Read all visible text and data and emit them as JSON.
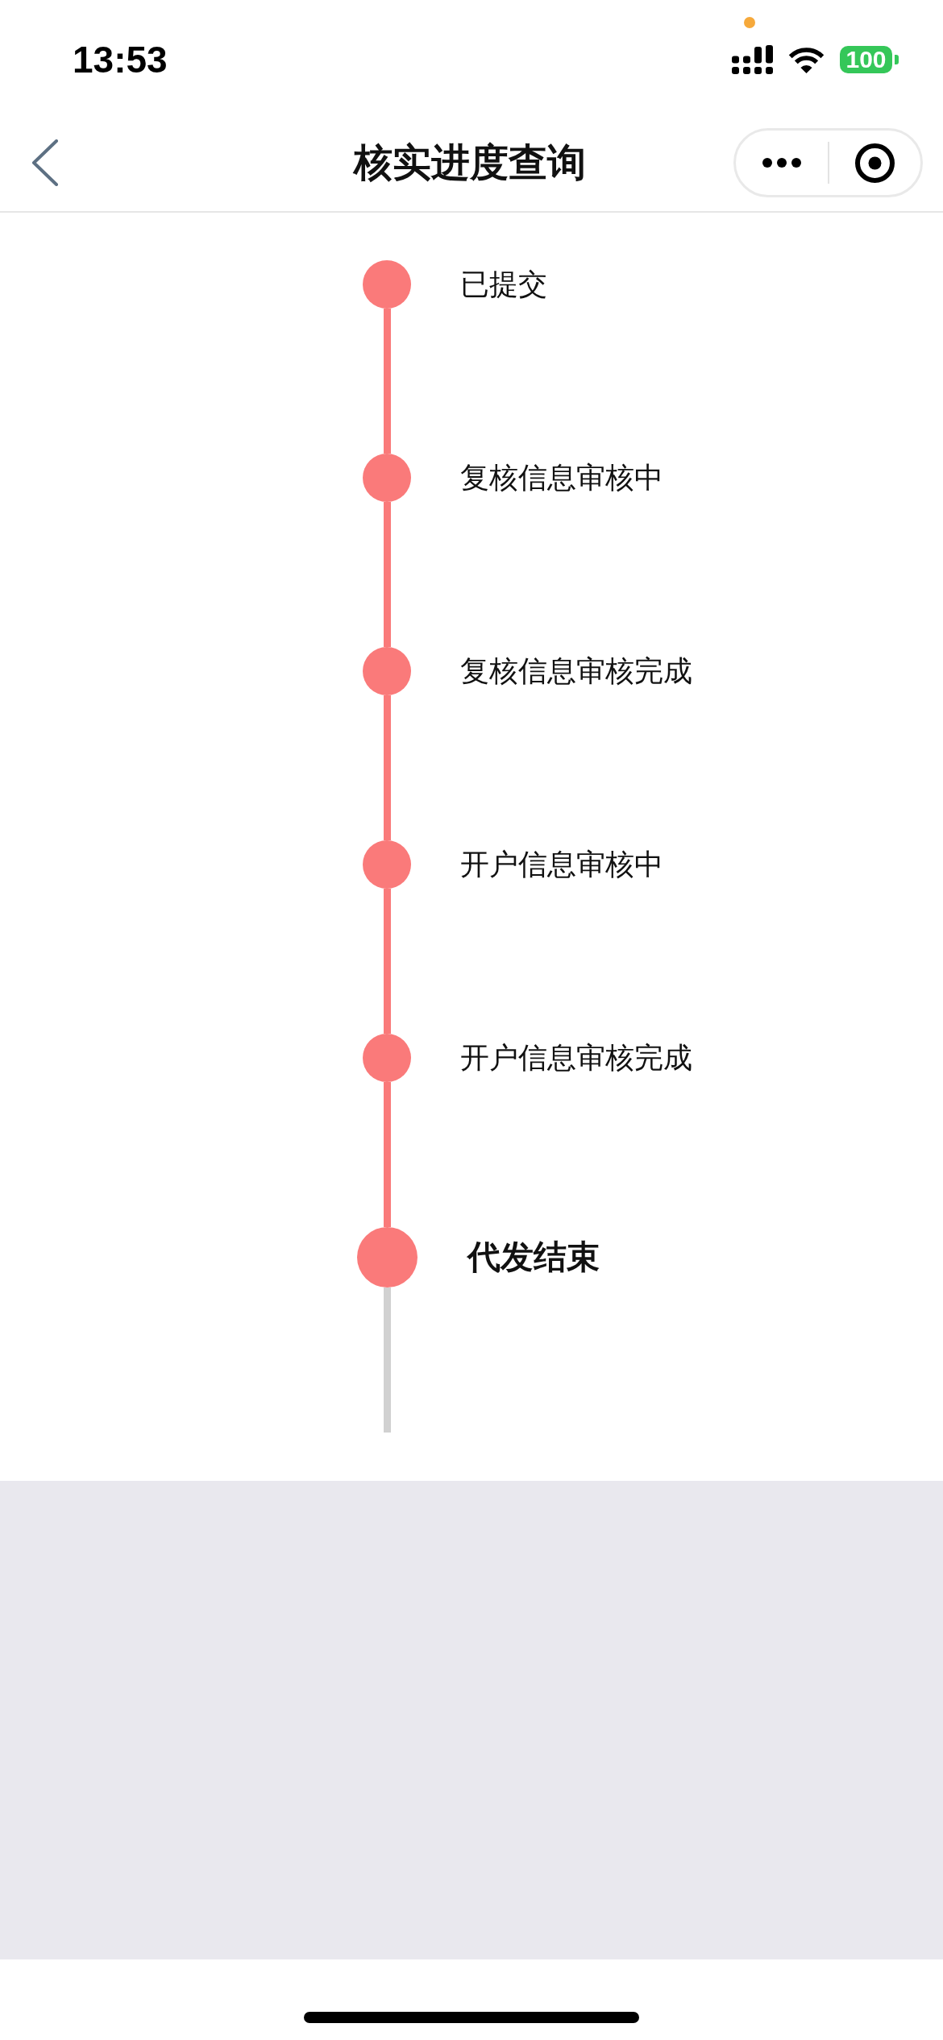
{
  "status_bar": {
    "time": "13:53",
    "battery": "100"
  },
  "nav_bar": {
    "title": "核实进度查询"
  },
  "timeline": {
    "steps": [
      {
        "label": "已提交",
        "completed": true,
        "current": false
      },
      {
        "label": "复核信息审核中",
        "completed": true,
        "current": false
      },
      {
        "label": "复核信息审核完成",
        "completed": true,
        "current": false
      },
      {
        "label": "开户信息审核中",
        "completed": true,
        "current": false
      },
      {
        "label": "开户信息审核完成",
        "completed": true,
        "current": false
      },
      {
        "label": "代发结束",
        "completed": true,
        "current": true
      }
    ]
  }
}
